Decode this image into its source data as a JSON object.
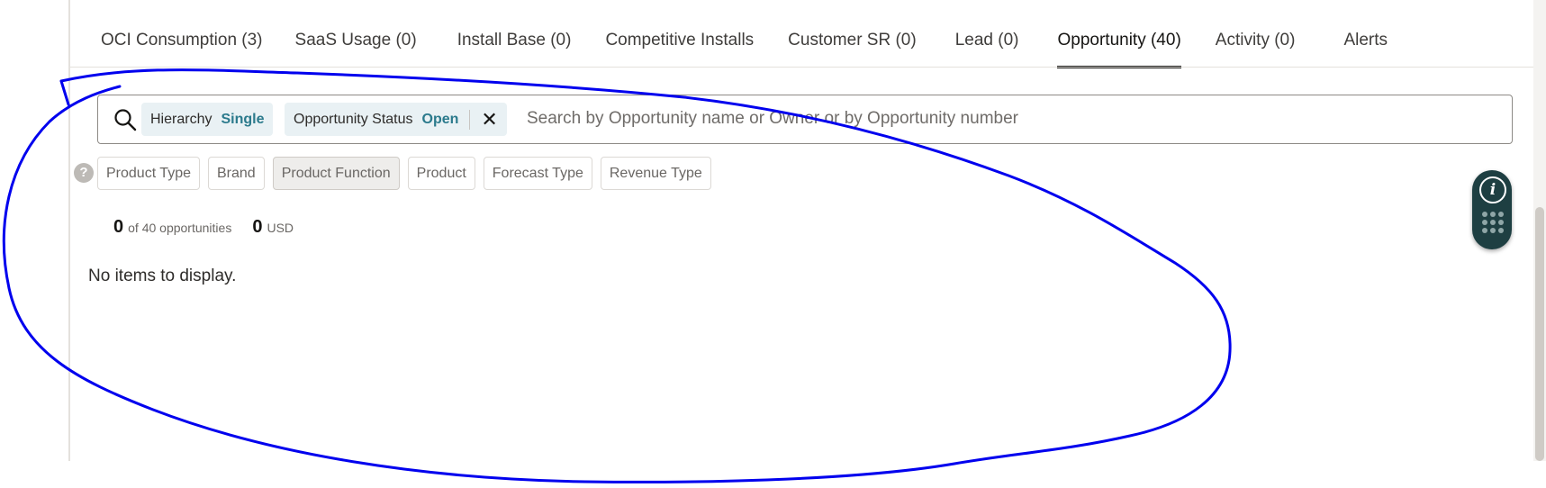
{
  "tabs": [
    {
      "label": "OCI Consumption (3)",
      "active": false
    },
    {
      "label": "SaaS Usage (0)",
      "active": false
    },
    {
      "label": "Install Base (0)",
      "active": false
    },
    {
      "label": "Competitive Installs",
      "active": false
    },
    {
      "label": "Customer SR (0)",
      "active": false
    },
    {
      "label": "Lead (0)",
      "active": false
    },
    {
      "label": "Opportunity (40)",
      "active": true
    },
    {
      "label": "Activity (0)",
      "active": false
    },
    {
      "label": "Alerts",
      "active": false
    }
  ],
  "search": {
    "chips": [
      {
        "label": "Hierarchy",
        "value": "Single"
      },
      {
        "label": "Opportunity Status",
        "value": "Open",
        "close": "✕"
      }
    ],
    "placeholder": "Search by Opportunity name or Owner or by Opportunity number"
  },
  "help_glyph": "?",
  "filters": [
    {
      "label": "Product Type",
      "pressed": false
    },
    {
      "label": "Brand",
      "pressed": false
    },
    {
      "label": "Product Function",
      "pressed": true
    },
    {
      "label": "Product",
      "pressed": false
    },
    {
      "label": "Forecast Type",
      "pressed": false
    },
    {
      "label": "Revenue Type",
      "pressed": false
    }
  ],
  "summary": {
    "count": "0",
    "count_suffix": "of 40 opportunities",
    "amount": "0",
    "currency": "USD"
  },
  "empty_message": "No items to display.",
  "helper_widget": {
    "info_glyph": "i"
  },
  "colors": {
    "accent": "#2b7a8c",
    "annotation": "#0000ee",
    "widget_bg": "#1e3f42",
    "chip_bg": "#e9f1f4"
  }
}
